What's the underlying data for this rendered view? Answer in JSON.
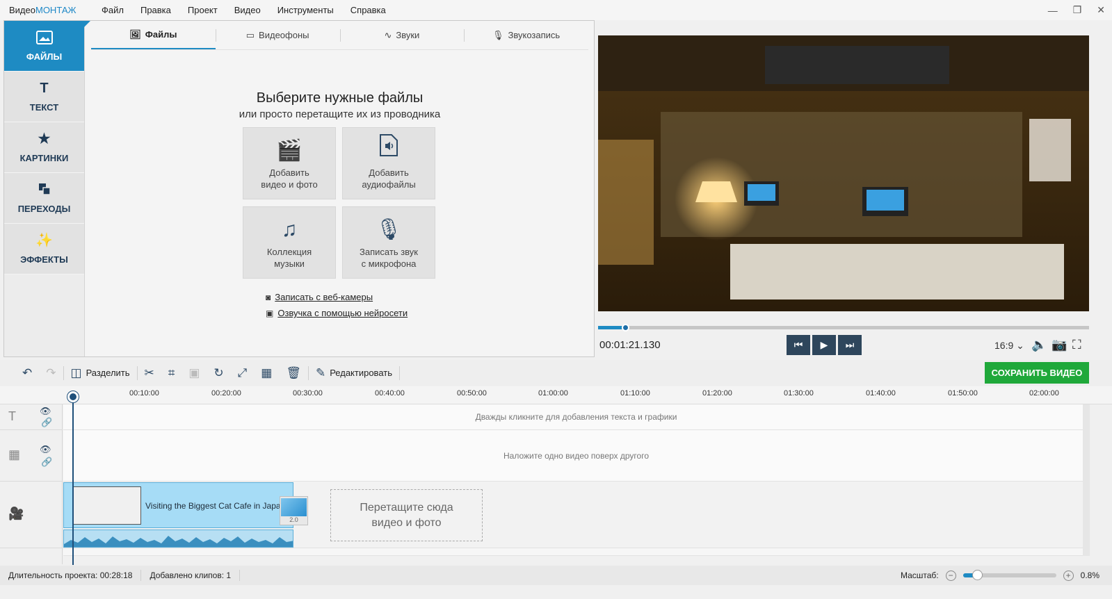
{
  "app": {
    "logo_part1": "Видео",
    "logo_part2": "МОНТАЖ",
    "menu": [
      "Файл",
      "Правка",
      "Проект",
      "Видео",
      "Инструменты",
      "Справка"
    ]
  },
  "sidebar": {
    "items": [
      {
        "label": "ФАЙЛЫ",
        "icon": "image-icon",
        "active": true
      },
      {
        "label": "ТЕКСТ",
        "icon": "text-icon",
        "active": false
      },
      {
        "label": "КАРТИНКИ",
        "icon": "star-icon",
        "active": false
      },
      {
        "label": "ПЕРЕХОДЫ",
        "icon": "transitions-icon",
        "active": false
      },
      {
        "label": "ЭФФЕКТЫ",
        "icon": "magic-wand-icon",
        "active": false
      }
    ]
  },
  "tabs": [
    {
      "label": "Файлы",
      "active": true
    },
    {
      "label": "Видеофоны",
      "active": false
    },
    {
      "label": "Звуки",
      "active": false
    },
    {
      "label": "Звукозапись",
      "active": false
    }
  ],
  "files_panel": {
    "heading": "Выберите нужные файлы",
    "subheading": "или просто перетащите их из проводника",
    "tiles": [
      {
        "line1": "Добавить",
        "line2": "видео и фото",
        "icon": "film-reel-icon"
      },
      {
        "line1": "Добавить",
        "line2": "аудиофайлы",
        "icon": "audio-file-icon"
      },
      {
        "line1": "Коллекция",
        "line2": "музыки",
        "icon": "music-notes-icon"
      },
      {
        "line1": "Записать звук",
        "line2": "с микрофона",
        "icon": "microphone-icon"
      }
    ],
    "links": [
      {
        "label": "Записать с веб-камеры",
        "icon": "webcam-icon"
      },
      {
        "label": "Озвучка с помощью нейросети",
        "icon": "ai-icon"
      }
    ]
  },
  "player": {
    "timecode": "00:01:21.130",
    "aspect": "16:9",
    "progress": 0.055
  },
  "toolbar": {
    "split_label": "Разделить",
    "edit_label": "Редактировать",
    "save_label": "СОХРАНИТЬ ВИДЕО"
  },
  "ruler": [
    "00:10:00",
    "00:20:00",
    "00:30:00",
    "00:40:00",
    "00:50:00",
    "01:00:00",
    "01:10:00",
    "01:20:00",
    "01:30:00",
    "01:40:00",
    "01:50:00",
    "02:00:00"
  ],
  "timeline": {
    "text_track_hint": "Дважды кликните для добавления текста и графики",
    "overlay_track_hint": "Наложите одно видео поверх другого",
    "clip_title": "Visiting the Biggest Cat Cafe in Japan",
    "transition_duration": "2.0",
    "drop_line1": "Перетащите сюда",
    "drop_line2": "видео и фото"
  },
  "status": {
    "duration": "Длительность проекта:  00:28:18",
    "clips": "Добавлено клипов: 1",
    "zoom_label": "Масштаб:",
    "zoom_value": "0.8%",
    "zoom_level": 0.15
  },
  "colors": {
    "accent": "#1e8bc3",
    "save": "#1fa83a",
    "clip": "#a6dcf6"
  }
}
